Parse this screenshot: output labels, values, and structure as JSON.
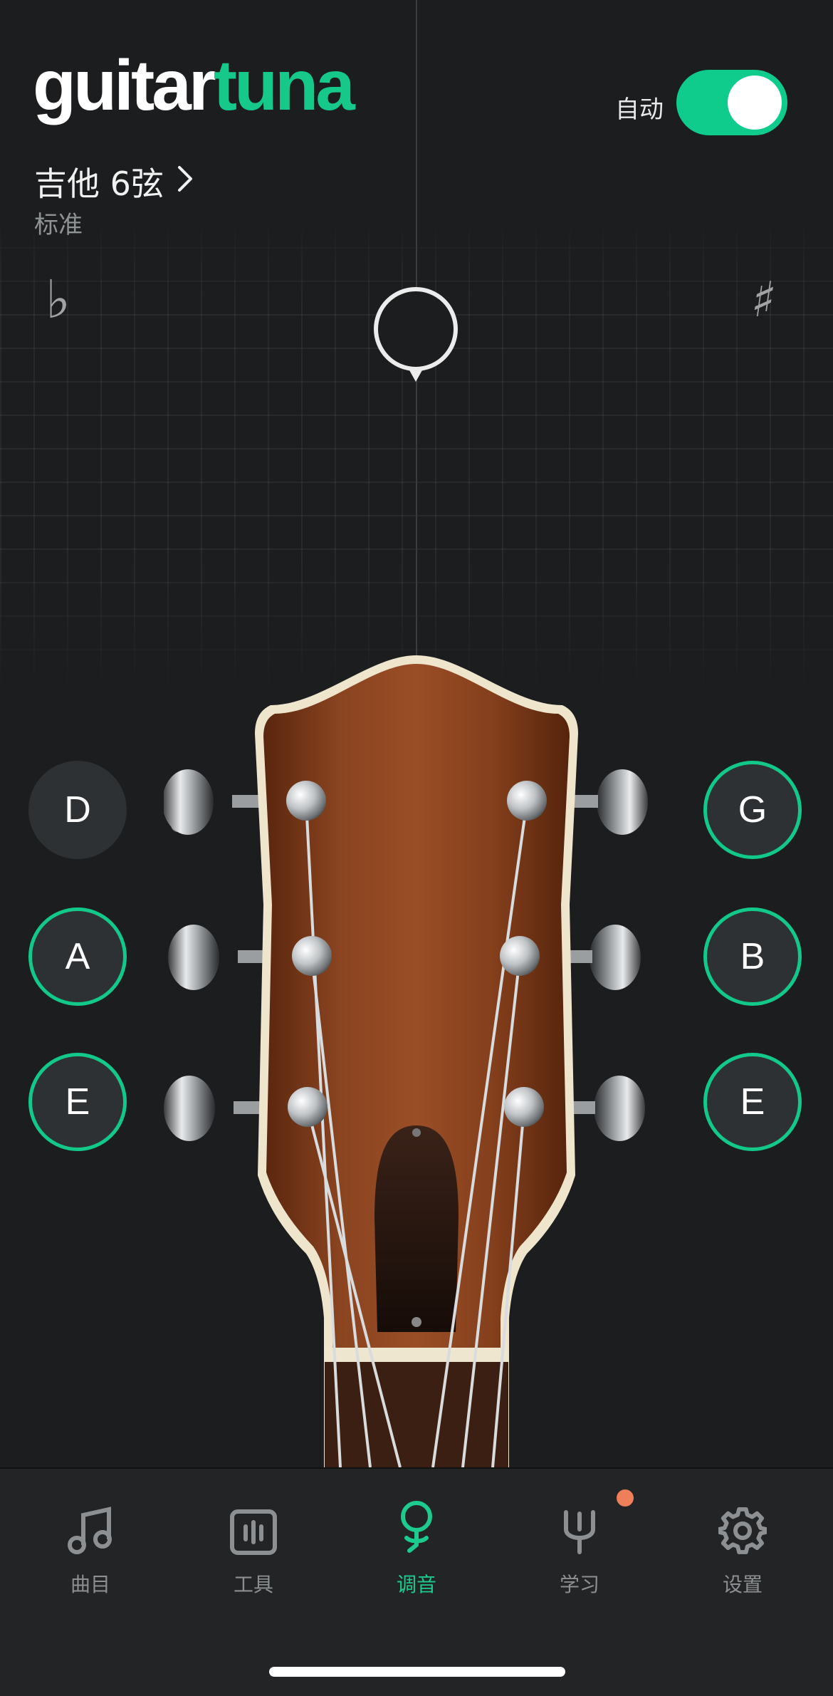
{
  "header": {
    "logo_part1": "guitar",
    "logo_part2": "tuna",
    "auto_label": "自动",
    "auto_enabled": true
  },
  "instrument": {
    "name": "吉他 6弦",
    "chevron": "›",
    "tuning": "标准"
  },
  "tuner": {
    "flat_symbol": "♭",
    "sharp_symbol": "♯"
  },
  "strings": {
    "left": [
      {
        "note": "D",
        "tuned": false
      },
      {
        "note": "A",
        "tuned": true
      },
      {
        "note": "E",
        "tuned": true
      }
    ],
    "right": [
      {
        "note": "G",
        "tuned": true
      },
      {
        "note": "B",
        "tuned": true
      },
      {
        "note": "E",
        "tuned": true
      }
    ]
  },
  "tabs": [
    {
      "label": "曲目",
      "icon": "music-note-icon",
      "active": false
    },
    {
      "label": "工具",
      "icon": "tools-icon",
      "active": false
    },
    {
      "label": "调音",
      "icon": "tuner-icon",
      "active": true
    },
    {
      "label": "学习",
      "icon": "learn-icon",
      "active": false,
      "badge": true
    },
    {
      "label": "设置",
      "icon": "gear-icon",
      "active": false
    }
  ],
  "colors": {
    "accent": "#16c98b",
    "background": "#1b1d1e",
    "badge": "#ee7f5a",
    "wood": "#7a3a18"
  }
}
